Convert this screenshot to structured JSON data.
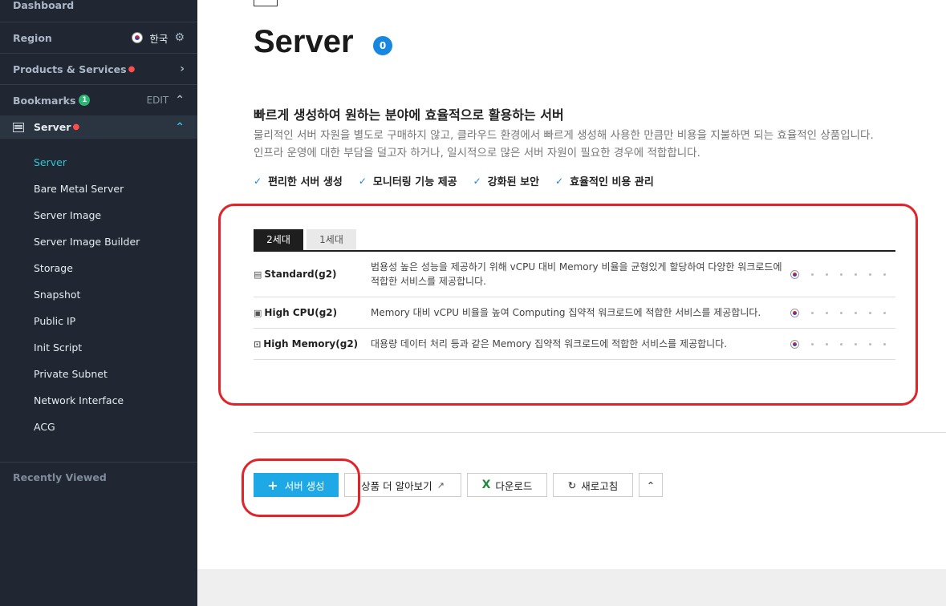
{
  "sidebar": {
    "dashboard": "Dashboard",
    "region_label": "Region",
    "region_value": "한국",
    "products_label": "Products & Services",
    "bookmarks_label": "Bookmarks",
    "bookmarks_count": "1",
    "bookmarks_edit": "EDIT",
    "server_label": "Server",
    "sub_items": [
      "Server",
      "Bare Metal Server",
      "Server Image",
      "Server Image Builder",
      "Storage",
      "Snapshot",
      "Public IP",
      "Init Script",
      "Private Subnet",
      "Network Interface",
      "ACG"
    ],
    "recently_viewed": "Recently Viewed"
  },
  "main": {
    "title": "Server",
    "count": "0",
    "headline": "빠르게 생성하여 원하는 분야에 효율적으로 활용하는 서버",
    "desc_line1": "물리적인 서버 자원을 별도로 구매하지 않고, 클라우드 환경에서 빠르게 생성해 사용한 만큼만 비용을 지불하면 되는 효율적인 상품입니다.",
    "desc_line2": "인프라 운영에 대한 부담을 덜고자 하거나, 일시적으로 많은 서버 자원이 필요한 경우에 적합합니다.",
    "features": [
      "편리한 서버 생성",
      "모니터링 기능 제공",
      "강화된 보안",
      "효율적인 비용 관리"
    ],
    "tabs": [
      "2세대",
      "1세대"
    ],
    "rows": [
      {
        "name": "Standard(g2)",
        "desc": "범용성 높은 성능을 제공하기 위해 vCPU 대비 Memory 비율을 균형있게 할당하여 다양한 워크로드에 적합한 서비스를 제공합니다."
      },
      {
        "name": "High CPU(g2)",
        "desc": "Memory 대비 vCPU 비율을 높여 Computing 집약적 워크로드에 적합한 서비스를 제공합니다."
      },
      {
        "name": "High Memory(g2)",
        "desc": "대용량 데이터 처리 등과 같은 Memory 집약적 워크로드에 적합한 서비스를 제공합니다."
      }
    ],
    "buttons": {
      "create": "서버 생성",
      "more": "상품 더 알아보기",
      "download": "다운로드",
      "refresh": "새로고침"
    }
  },
  "colors": {
    "sidebar_bg": "#202732",
    "accent_teal": "#32c5d2",
    "primary_blue": "#1ea9e6",
    "badge_blue": "#1787e0",
    "highlight_red": "#e0242a"
  }
}
